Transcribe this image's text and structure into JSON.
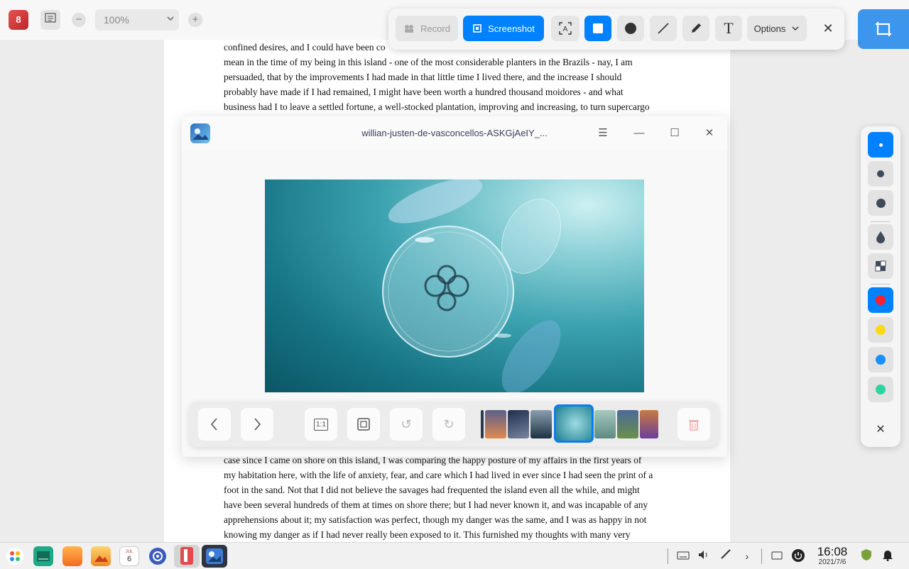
{
  "reader": {
    "app_icon": "book-reader-icon",
    "app_icon_text": "8",
    "zoom_value": "100%",
    "zoom_out_glyph": "−",
    "zoom_in_glyph": "+",
    "dropdown_glyph": "⌄",
    "top_lines": [
      "confined desires, and I could have been co",
      "mean in the time of my being in this island - one of the most considerable planters in the Brazils - nay, I am",
      "persuaded, that by the improvements I had made in that little time I lived there, and the increase I should",
      "probably have made if I had remained, I might have been worth a hundred thousand moidores - and what",
      "business had I to leave a settled fortune, a well-stocked plantation, improving and increasing, to turn supercargo"
    ],
    "bottom_lines": [
      "case since I came on shore on this island, I was comparing the happy posture of my affairs in the first years of",
      "my habitation here, with the life of anxiety, fear, and care which I had lived in ever since I had seen the print of a",
      "foot in the sand. Not that I did not believe the savages had frequented the island even all the while, and might",
      "have been several hundreds of them at times on shore there; but I had never known it, and was incapable of any",
      "apprehensions about it; my satisfaction was perfect, though my danger was the same, and I was as happy in not",
      "knowing my danger as if I had never really been exposed to it. This furnished my thoughts with many very"
    ]
  },
  "toolbar": {
    "record_label": "Record",
    "screenshot_label": "Screenshot",
    "options_label": "Options",
    "close_glyph": "✕",
    "text_glyph": "T",
    "ocr_glyph": "A",
    "accent_color": "#0081ff"
  },
  "side_panel": {
    "colors": [
      "#f5222d",
      "#fadb14",
      "#1890ff",
      "#2ed3a0"
    ],
    "close_glyph": "✕"
  },
  "viewer": {
    "title": "willian-justen-de-vasconcellos-ASKGjAeIY_...",
    "menu_glyph": "☰",
    "minimize_glyph": "—",
    "maximize_glyph": "☐",
    "close_glyph": "✕",
    "prev_glyph": "‹",
    "next_glyph": "›",
    "one_to_one_glyph": "1:1",
    "rotate_left_glyph": "↺",
    "rotate_right_glyph": "↻",
    "delete_glyph": "🗑",
    "thumbnails": [
      "dark-landscape",
      "sunset-mountains",
      "desert-dunes",
      "forest",
      "jellyfish",
      "misty-forest",
      "lake-mountains",
      "lavender-sunset"
    ]
  },
  "taskbar": {
    "calendar_month": "JUL",
    "calendar_day": "6",
    "time": "16:08",
    "date": "2021/7/6",
    "chevron_glyph": "›"
  }
}
